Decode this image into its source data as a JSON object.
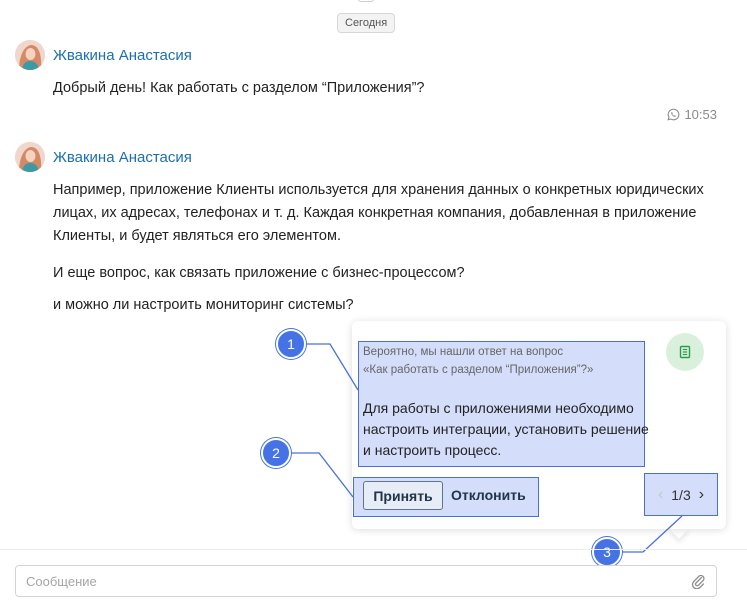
{
  "chat": {
    "date_separator": "Сегодня",
    "messages": [
      {
        "author": "Жвакина Анастасия",
        "lines": [
          "Добрый день! Как работать с разделом “Приложения”?"
        ],
        "time": "10:53"
      },
      {
        "author": "Жвакина Анастасия",
        "lines": [
          "Например, приложение Клиенты используется для хранения данных о конкретных юридических",
          "лицах, их адресах, телефонах и т. д. Каждая конкретная компания, добавленная в приложение",
          "Клиенты, и будет являться его элементом.",
          "И еще вопрос, как связать приложение с бизнес-процессом?",
          "и можно ли настроить мониторинг системы?"
        ]
      }
    ]
  },
  "suggestion": {
    "intro_line1": "Вероятно, мы нашли ответ на вопрос",
    "intro_line2": "«Как работать с разделом “Приложения”?»",
    "answer_lines": [
      "Для работы с приложениями необходимо",
      "настроить интеграции, установить решение",
      "и настроить процесс."
    ],
    "accept_label": "Принять",
    "decline_label": "Отклонить",
    "pager": "1/3"
  },
  "callouts": [
    "1",
    "2",
    "3"
  ],
  "composer": {
    "placeholder": "Сообщение",
    "value": ""
  },
  "icons": {
    "avatar": "avatar-photo",
    "time": "whatsapp-icon",
    "suggestion_action": "book-icon",
    "pager_prev": "chevron-left-icon",
    "pager_next": "chevron-right-icon",
    "composer_attach": "paperclip-icon"
  },
  "colors": {
    "author": "#1c6fb0",
    "highlight_border": "#4a6fd8",
    "badge": "#4573e6",
    "book_button_bg": "#d9f1dc"
  }
}
